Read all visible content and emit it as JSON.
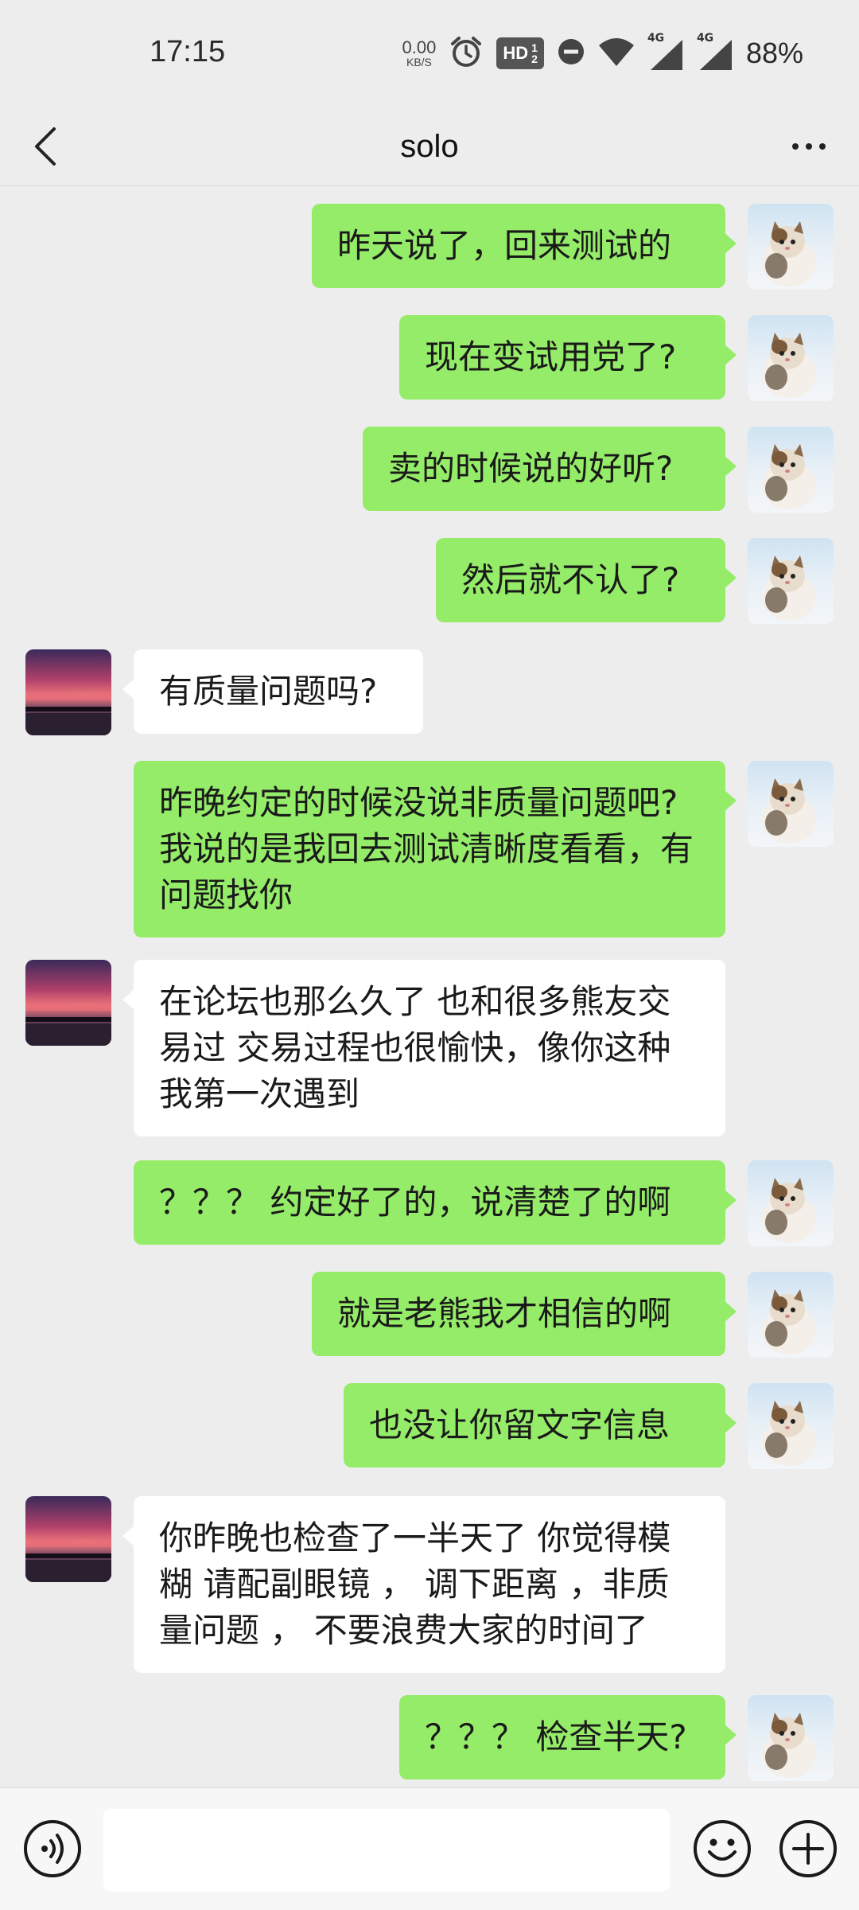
{
  "status_bar": {
    "time": "17:15",
    "net_speed_value": "0.00",
    "net_speed_unit": "KB/S",
    "hd_label": "HD",
    "hd_frac_top": "1",
    "hd_frac_bottom": "2",
    "signal1_tag": "4G",
    "signal2_tag": "4G",
    "battery": "88%",
    "icons": [
      "alarm-icon",
      "hd-voice-icon",
      "do-not-disturb-icon",
      "wifi-icon",
      "signal-icon",
      "signal-icon"
    ]
  },
  "header": {
    "title": "solo",
    "back_icon": "chevron-left-icon",
    "more_icon": "more-dots-icon"
  },
  "messages": [
    {
      "from": "me",
      "text": "昨天说了，回来测试的"
    },
    {
      "from": "me",
      "text": "现在变试用党了?"
    },
    {
      "from": "me",
      "text": "卖的时候说的好听?"
    },
    {
      "from": "me",
      "text": "然后就不认了?"
    },
    {
      "from": "peer",
      "text": "有质量问题吗?"
    },
    {
      "from": "me",
      "text": "昨晚约定的时候没说非质量问题吧? 我说的是我回去测试清晰度看看，有问题找你"
    },
    {
      "from": "peer",
      "text": "在论坛也那么久了  也和很多熊友交易过 交易过程也很愉快，像你这种我第一次遇到"
    },
    {
      "from": "me",
      "text": "？？？ 约定好了的，说清楚了的啊"
    },
    {
      "from": "me",
      "text": "就是老熊我才相信的啊"
    },
    {
      "from": "me",
      "text": "也没让你留文字信息"
    },
    {
      "from": "peer",
      "text": "你昨晚也检查了一半天了 你觉得模糊 请配副眼镜 ， 调下距离 ，非质量问题 ， 不要浪费大家的时间了"
    },
    {
      "from": "me",
      "text": "？？？ 检查半天?"
    }
  ],
  "colors": {
    "background": "#ededed",
    "my_bubble": "#95ec69",
    "peer_bubble": "#ffffff"
  },
  "input_bar": {
    "placeholder": "",
    "voice_icon": "voice-icon",
    "emoji_icon": "emoji-icon",
    "plus_icon": "plus-icon"
  }
}
